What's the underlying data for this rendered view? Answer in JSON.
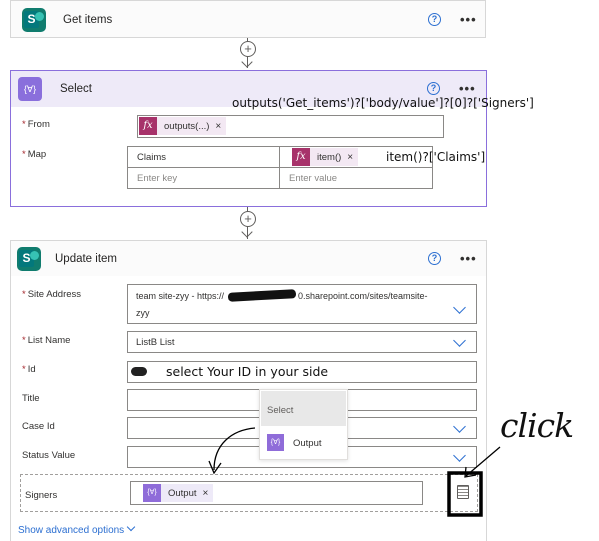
{
  "get_items": {
    "title": "Get items",
    "help": "?",
    "more": "•••"
  },
  "select": {
    "title": "Select",
    "icon": "{∀}",
    "help": "?",
    "more": "•••",
    "from": {
      "label": "From",
      "token": "outputs(...)",
      "token_icon": "fx",
      "remove": "×"
    },
    "map": {
      "label": "Map",
      "key_value": "Claims",
      "key_placeholder": "Enter key",
      "value_token": "item()",
      "value_token_icon": "fx",
      "value_remove": "×",
      "value_placeholder": "Enter value"
    }
  },
  "update_item": {
    "title": "Update item",
    "help": "?",
    "more": "•••",
    "site_address": {
      "label": "Site Address",
      "value_line1": "team site-zyy - https://",
      "value_mid": "0.sharepoint.com/sites/teamsite-",
      "value_line2": "zyy"
    },
    "list_name": {
      "label": "List Name",
      "value": "ListB List"
    },
    "id": {
      "label": "Id"
    },
    "title_field": {
      "label": "Title"
    },
    "case_id": {
      "label": "Case Id"
    },
    "status_value": {
      "label": "Status Value"
    },
    "signers": {
      "label": "Signers",
      "token": "Output",
      "token_icon": "{∀}",
      "remove": "×"
    },
    "show_advanced": "Show advanced options"
  },
  "dropdown_popup": {
    "header": "Select",
    "item": "Output",
    "item_icon": "{∀}"
  },
  "annotations": {
    "outputs_expr": "outputs('Get_items')?['body/value']?[0]?['Signers']",
    "item_expr": "item()?['Claims']",
    "select_id": "select Your ID in your side",
    "click": "click"
  },
  "colors": {
    "select_accent": "#8a6fdc",
    "sharepoint": "#03787c",
    "link": "#2c6fd1"
  }
}
